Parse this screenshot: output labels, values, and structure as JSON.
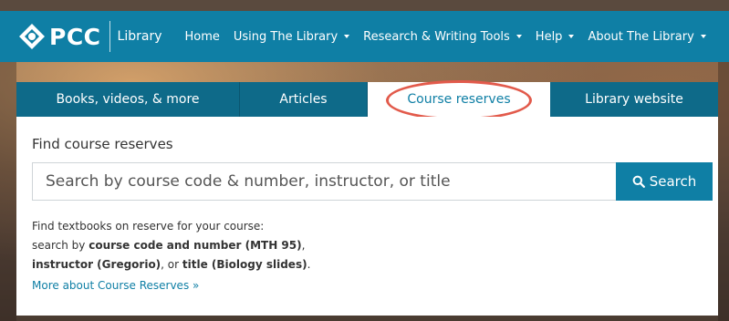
{
  "header": {
    "logo_text": "PCC",
    "logo_sub": "Library",
    "nav": [
      {
        "label": "Home"
      },
      {
        "label": "Using The Library"
      },
      {
        "label": "Research & Writing Tools"
      },
      {
        "label": "Help"
      },
      {
        "label": "About The Library"
      }
    ]
  },
  "tabs": [
    {
      "label": "Books, videos, & more"
    },
    {
      "label": "Articles"
    },
    {
      "label": "Course reserves"
    },
    {
      "label": "Library website"
    }
  ],
  "panel": {
    "title": "Find course reserves",
    "search_placeholder": "Search by course code & number, instructor, or title",
    "search_button": "Search",
    "help_line1": "Find textbooks on reserve for your course:",
    "help_line2_prefix": "search by ",
    "help_line2_bold": "course code and number (MTH 95)",
    "help_line2_suffix": ",",
    "help_line3_bold1": "instructor (Gregorio)",
    "help_line3_mid": ", or ",
    "help_line3_bold2": "title (Biology slides)",
    "help_line3_suffix": ".",
    "more_link": "More about Course Reserves »"
  },
  "colors": {
    "brand": "#0f7fa5",
    "tab_dark": "#0e6a89",
    "highlight": "#e25a4b"
  },
  "icons": {
    "logo": "pcc-diamond-logo-icon",
    "search": "search-icon",
    "dropdown": "caret-down-icon"
  }
}
